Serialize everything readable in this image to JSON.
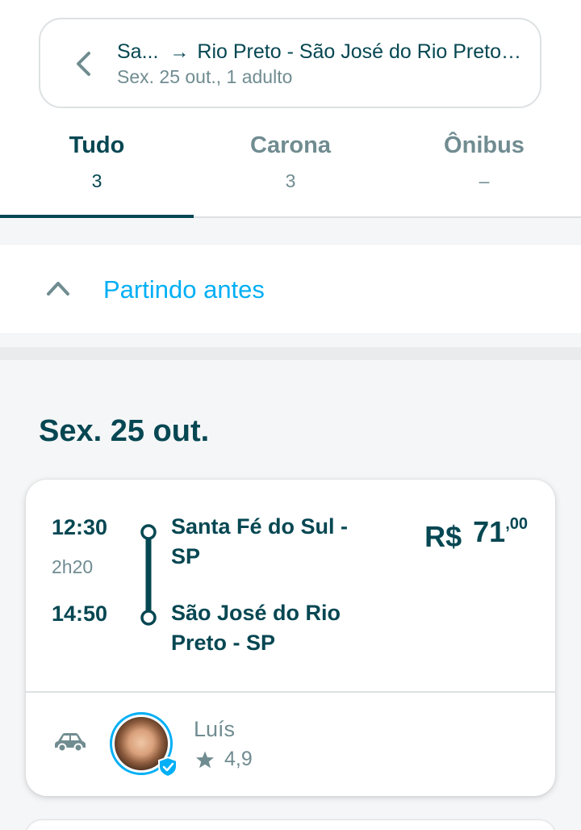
{
  "search": {
    "origin": "Sa...",
    "destination": "Rio Preto - São José do Rio Preto, ...",
    "details": "Sex. 25 out., 1 adulto"
  },
  "tabs": [
    {
      "label": "Tudo",
      "count": "3",
      "active": true
    },
    {
      "label": "Carona",
      "count": "3",
      "active": false
    },
    {
      "label": "Ônibus",
      "count": "–",
      "active": false
    }
  ],
  "earlier": {
    "label": "Partindo antes"
  },
  "date_heading": "Sex. 25 out.",
  "ride": {
    "departure_time": "12:30",
    "duration": "2h20",
    "arrival_time": "14:50",
    "departure_city": "Santa Fé do Sul - SP",
    "arrival_city": "São José do Rio Preto - SP",
    "price_currency": "R$",
    "price_integer": "71",
    "price_cents": ",00",
    "driver_name": "Luís",
    "driver_rating": "4,9"
  },
  "colors": {
    "primary": "#054752",
    "accent": "#00aff5",
    "muted": "#708c91"
  },
  "icons": {
    "back": "chevron-left-icon",
    "earlier": "chevron-up-icon",
    "vehicle": "car-icon",
    "rating": "star-icon",
    "verified": "shield-check-icon"
  }
}
